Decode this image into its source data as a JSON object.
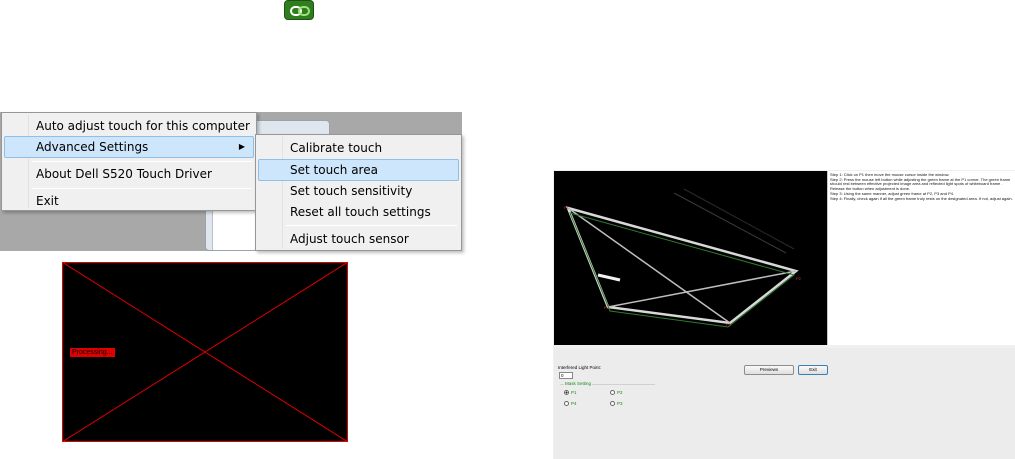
{
  "tray": {
    "icon": "chain-link-icon"
  },
  "context_menu": {
    "items": [
      {
        "label": "Auto adjust touch for this computer"
      },
      {
        "label": "Advanced Settings",
        "has_submenu": true,
        "highlighted": true
      },
      {
        "label": "About Dell S520 Touch Driver"
      },
      {
        "label": "Exit"
      }
    ]
  },
  "submenu": {
    "items": [
      {
        "label": "Calibrate touch"
      },
      {
        "label": "Set touch area",
        "highlighted": true
      },
      {
        "label": "Set touch sensitivity"
      },
      {
        "label": "Reset all touch settings"
      },
      {
        "label": "Adjust touch sensor"
      }
    ]
  },
  "touch_area": {
    "status_label": "Processing...",
    "line_color": "#e00000"
  },
  "app_window": {
    "instructions": [
      "Step 1: Click on P1 then move the mouse cursor inside the window.",
      "Step 2: Press the mouse left button while adjusting the green frame at the P1 corner. The green frame should rest between effective projected image area and reflected light spots of whiteboard frame . Release the button when adjustment is done.",
      "Step 3: Using the same manner, adjust green frame at P2, P3 and P4.",
      "Step 4: Finally, check again if all the green frame truly rests on the designated area. If not, adjust again."
    ],
    "markers": [
      "P1",
      "P2",
      "P3",
      "P4"
    ],
    "interfered_light_label": "Interfered Light Point:",
    "interfered_light_value": "0",
    "previews_label": "Previews",
    "exit_label": "Exit",
    "mask_setting_label": "Mask Setting",
    "radios": [
      {
        "label": "P1",
        "selected": true
      },
      {
        "label": "P2",
        "selected": false
      },
      {
        "label": "P4",
        "selected": false
      },
      {
        "label": "P3",
        "selected": false
      }
    ],
    "accent_green": "#1a8a1a"
  }
}
